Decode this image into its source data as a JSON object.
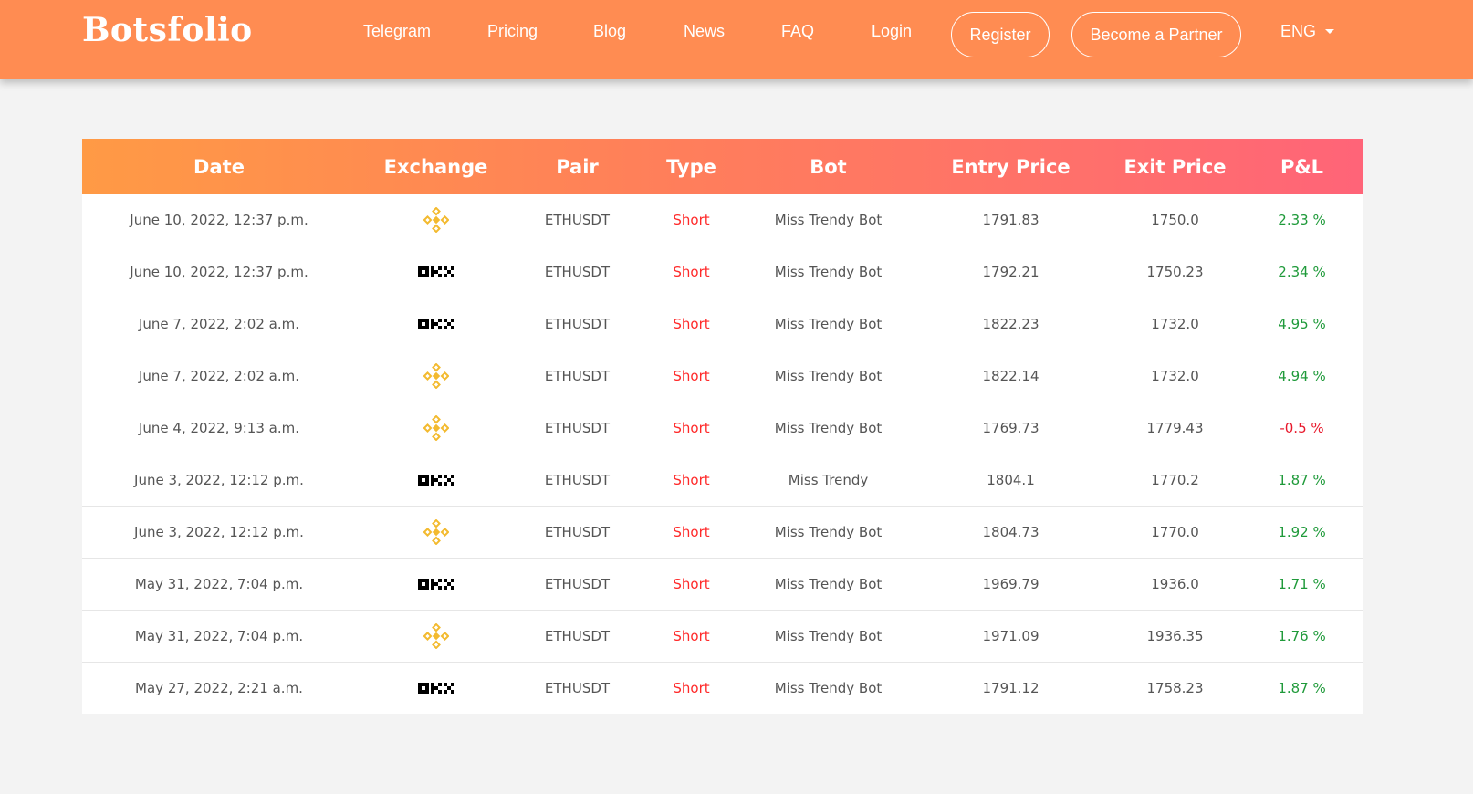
{
  "brand": "Botsfolio",
  "nav": {
    "telegram": "Telegram",
    "pricing": "Pricing",
    "blog": "Blog",
    "news": "News",
    "faq": "FAQ",
    "login": "Login",
    "register": "Register",
    "partner": "Become a Partner",
    "language": "ENG"
  },
  "table": {
    "headers": [
      "Date",
      "Exchange",
      "Pair",
      "Type",
      "Bot",
      "Entry Price",
      "Exit Price",
      "P&L"
    ],
    "rows": [
      {
        "date": "June 10, 2022, 12:37 p.m.",
        "exchange": "binance",
        "pair": "ETHUSDT",
        "type": "Short",
        "bot": "Miss Trendy Bot",
        "entry": "1791.83",
        "exit": "1750.0",
        "pl": "2.33 %",
        "sign": "pos"
      },
      {
        "date": "June 10, 2022, 12:37 p.m.",
        "exchange": "okx",
        "pair": "ETHUSDT",
        "type": "Short",
        "bot": "Miss Trendy Bot",
        "entry": "1792.21",
        "exit": "1750.23",
        "pl": "2.34 %",
        "sign": "pos"
      },
      {
        "date": "June 7, 2022, 2:02 a.m.",
        "exchange": "okx",
        "pair": "ETHUSDT",
        "type": "Short",
        "bot": "Miss Trendy Bot",
        "entry": "1822.23",
        "exit": "1732.0",
        "pl": "4.95 %",
        "sign": "pos"
      },
      {
        "date": "June 7, 2022, 2:02 a.m.",
        "exchange": "binance",
        "pair": "ETHUSDT",
        "type": "Short",
        "bot": "Miss Trendy Bot",
        "entry": "1822.14",
        "exit": "1732.0",
        "pl": "4.94 %",
        "sign": "pos"
      },
      {
        "date": "June 4, 2022, 9:13 a.m.",
        "exchange": "binance",
        "pair": "ETHUSDT",
        "type": "Short",
        "bot": "Miss Trendy Bot",
        "entry": "1769.73",
        "exit": "1779.43",
        "pl": "-0.5 %",
        "sign": "neg"
      },
      {
        "date": "June 3, 2022, 12:12 p.m.",
        "exchange": "okx",
        "pair": "ETHUSDT",
        "type": "Short",
        "bot": "Miss Trendy",
        "entry": "1804.1",
        "exit": "1770.2",
        "pl": "1.87 %",
        "sign": "pos"
      },
      {
        "date": "June 3, 2022, 12:12 p.m.",
        "exchange": "binance",
        "pair": "ETHUSDT",
        "type": "Short",
        "bot": "Miss Trendy Bot",
        "entry": "1804.73",
        "exit": "1770.0",
        "pl": "1.92 %",
        "sign": "pos"
      },
      {
        "date": "May 31, 2022, 7:04 p.m.",
        "exchange": "okx",
        "pair": "ETHUSDT",
        "type": "Short",
        "bot": "Miss Trendy Bot",
        "entry": "1969.79",
        "exit": "1936.0",
        "pl": "1.71 %",
        "sign": "pos"
      },
      {
        "date": "May 31, 2022, 7:04 p.m.",
        "exchange": "binance",
        "pair": "ETHUSDT",
        "type": "Short",
        "bot": "Miss Trendy Bot",
        "entry": "1971.09",
        "exit": "1936.35",
        "pl": "1.76 %",
        "sign": "pos"
      },
      {
        "date": "May 27, 2022, 2:21 a.m.",
        "exchange": "okx",
        "pair": "ETHUSDT",
        "type": "Short",
        "bot": "Miss Trendy Bot",
        "entry": "1791.12",
        "exit": "1758.23",
        "pl": "1.87 %",
        "sign": "pos"
      }
    ]
  },
  "colors": {
    "navbar": "#ff8c52",
    "short": "#ff2a2a",
    "profit": "#1f9a3a",
    "loss": "#e8192c",
    "binance": "#f3ba2f",
    "okx": "#000000"
  }
}
